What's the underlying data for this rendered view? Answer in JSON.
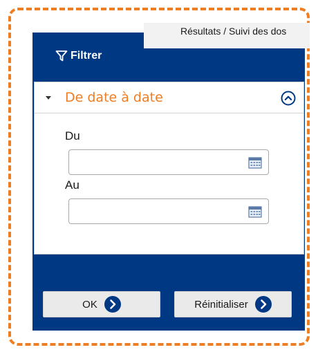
{
  "breadcrumb": {
    "text": "Résultats / Suivi des dos"
  },
  "filter": {
    "title": "Filtrer"
  },
  "section": {
    "title": "De date à date"
  },
  "fields": {
    "from_label": "Du",
    "from_value": "",
    "to_label": "Au",
    "to_value": ""
  },
  "buttons": {
    "ok_label": "OK",
    "reset_label": "Réinitialiser"
  },
  "colors": {
    "accent_orange": "#ef7d22",
    "panel_navy": "#003883"
  },
  "icons": [
    "funnel-icon",
    "caret-down-icon",
    "chevron-up-circle-icon",
    "calendar-icon",
    "arrow-right-circle-icon"
  ]
}
